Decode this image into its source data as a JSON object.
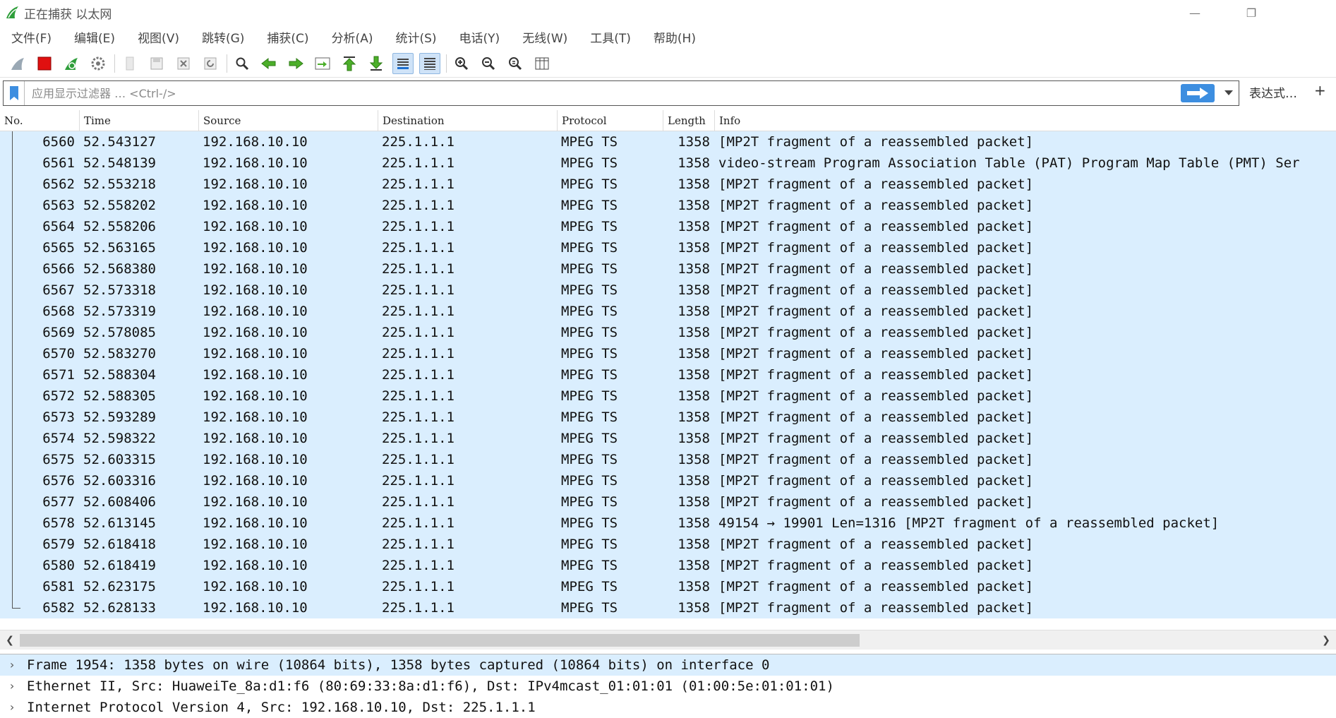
{
  "window": {
    "title": "正在捕获 以太网",
    "controls": {
      "minimize": "—",
      "restore": "❐",
      "close": ""
    }
  },
  "menu": [
    "文件(F)",
    "编辑(E)",
    "视图(V)",
    "跳转(G)",
    "捕获(C)",
    "分析(A)",
    "统计(S)",
    "电话(Y)",
    "无线(W)",
    "工具(T)",
    "帮助(H)"
  ],
  "toolbar": {
    "icons": [
      "shark-fin-icon",
      "stop-capture-icon",
      "restart-capture-icon",
      "capture-options-icon",
      "open-file-icon",
      "save-file-icon",
      "close-file-icon",
      "reload-file-icon",
      "find-packet-icon",
      "go-back-icon",
      "go-forward-icon",
      "go-to-packet-icon",
      "go-first-icon",
      "go-last-icon",
      "autoscroll-icon",
      "colorize-icon",
      "zoom-in-icon",
      "zoom-out-icon",
      "zoom-normal-icon",
      "resize-columns-icon"
    ]
  },
  "filter": {
    "placeholder": "应用显示过滤器 … <Ctrl-/>",
    "value": "",
    "expression_label": "表达式…",
    "right_label": "+"
  },
  "packet_list": {
    "columns": [
      "No.",
      "Time",
      "Source",
      "Destination",
      "Protocol",
      "Length",
      "Info"
    ],
    "rows": [
      {
        "no": "6560",
        "time": "52.543127",
        "src": "192.168.10.10",
        "dst": "225.1.1.1",
        "proto": "MPEG TS",
        "len": "1358",
        "info": "[MP2T fragment of a reassembled packet]"
      },
      {
        "no": "6561",
        "time": "52.548139",
        "src": "192.168.10.10",
        "dst": "225.1.1.1",
        "proto": "MPEG TS",
        "len": "1358",
        "info": "video-stream  Program Association Table (PAT) Program Map Table (PMT) Ser"
      },
      {
        "no": "6562",
        "time": "52.553218",
        "src": "192.168.10.10",
        "dst": "225.1.1.1",
        "proto": "MPEG TS",
        "len": "1358",
        "info": "[MP2T fragment of a reassembled packet]"
      },
      {
        "no": "6563",
        "time": "52.558202",
        "src": "192.168.10.10",
        "dst": "225.1.1.1",
        "proto": "MPEG TS",
        "len": "1358",
        "info": "[MP2T fragment of a reassembled packet]"
      },
      {
        "no": "6564",
        "time": "52.558206",
        "src": "192.168.10.10",
        "dst": "225.1.1.1",
        "proto": "MPEG TS",
        "len": "1358",
        "info": "[MP2T fragment of a reassembled packet]"
      },
      {
        "no": "6565",
        "time": "52.563165",
        "src": "192.168.10.10",
        "dst": "225.1.1.1",
        "proto": "MPEG TS",
        "len": "1358",
        "info": "[MP2T fragment of a reassembled packet]"
      },
      {
        "no": "6566",
        "time": "52.568380",
        "src": "192.168.10.10",
        "dst": "225.1.1.1",
        "proto": "MPEG TS",
        "len": "1358",
        "info": "[MP2T fragment of a reassembled packet]"
      },
      {
        "no": "6567",
        "time": "52.573318",
        "src": "192.168.10.10",
        "dst": "225.1.1.1",
        "proto": "MPEG TS",
        "len": "1358",
        "info": "[MP2T fragment of a reassembled packet]"
      },
      {
        "no": "6568",
        "time": "52.573319",
        "src": "192.168.10.10",
        "dst": "225.1.1.1",
        "proto": "MPEG TS",
        "len": "1358",
        "info": "[MP2T fragment of a reassembled packet]"
      },
      {
        "no": "6569",
        "time": "52.578085",
        "src": "192.168.10.10",
        "dst": "225.1.1.1",
        "proto": "MPEG TS",
        "len": "1358",
        "info": "[MP2T fragment of a reassembled packet]"
      },
      {
        "no": "6570",
        "time": "52.583270",
        "src": "192.168.10.10",
        "dst": "225.1.1.1",
        "proto": "MPEG TS",
        "len": "1358",
        "info": "[MP2T fragment of a reassembled packet]"
      },
      {
        "no": "6571",
        "time": "52.588304",
        "src": "192.168.10.10",
        "dst": "225.1.1.1",
        "proto": "MPEG TS",
        "len": "1358",
        "info": "[MP2T fragment of a reassembled packet]"
      },
      {
        "no": "6572",
        "time": "52.588305",
        "src": "192.168.10.10",
        "dst": "225.1.1.1",
        "proto": "MPEG TS",
        "len": "1358",
        "info": "[MP2T fragment of a reassembled packet]"
      },
      {
        "no": "6573",
        "time": "52.593289",
        "src": "192.168.10.10",
        "dst": "225.1.1.1",
        "proto": "MPEG TS",
        "len": "1358",
        "info": "[MP2T fragment of a reassembled packet]"
      },
      {
        "no": "6574",
        "time": "52.598322",
        "src": "192.168.10.10",
        "dst": "225.1.1.1",
        "proto": "MPEG TS",
        "len": "1358",
        "info": "[MP2T fragment of a reassembled packet]"
      },
      {
        "no": "6575",
        "time": "52.603315",
        "src": "192.168.10.10",
        "dst": "225.1.1.1",
        "proto": "MPEG TS",
        "len": "1358",
        "info": "[MP2T fragment of a reassembled packet]"
      },
      {
        "no": "6576",
        "time": "52.603316",
        "src": "192.168.10.10",
        "dst": "225.1.1.1",
        "proto": "MPEG TS",
        "len": "1358",
        "info": "[MP2T fragment of a reassembled packet]"
      },
      {
        "no": "6577",
        "time": "52.608406",
        "src": "192.168.10.10",
        "dst": "225.1.1.1",
        "proto": "MPEG TS",
        "len": "1358",
        "info": "[MP2T fragment of a reassembled packet]"
      },
      {
        "no": "6578",
        "time": "52.613145",
        "src": "192.168.10.10",
        "dst": "225.1.1.1",
        "proto": "MPEG TS",
        "len": "1358",
        "info": "49154 → 19901 Len=1316 [MP2T fragment of a reassembled packet]"
      },
      {
        "no": "6579",
        "time": "52.618418",
        "src": "192.168.10.10",
        "dst": "225.1.1.1",
        "proto": "MPEG TS",
        "len": "1358",
        "info": "[MP2T fragment of a reassembled packet]"
      },
      {
        "no": "6580",
        "time": "52.618419",
        "src": "192.168.10.10",
        "dst": "225.1.1.1",
        "proto": "MPEG TS",
        "len": "1358",
        "info": "[MP2T fragment of a reassembled packet]"
      },
      {
        "no": "6581",
        "time": "52.623175",
        "src": "192.168.10.10",
        "dst": "225.1.1.1",
        "proto": "MPEG TS",
        "len": "1358",
        "info": "[MP2T fragment of a reassembled packet]"
      },
      {
        "no": "6582",
        "time": "52.628133",
        "src": "192.168.10.10",
        "dst": "225.1.1.1",
        "proto": "MPEG TS",
        "len": "1358",
        "info": "[MP2T fragment of a reassembled packet]"
      }
    ]
  },
  "details": [
    {
      "text": "Frame 1954: 1358 bytes on wire (10864 bits), 1358 bytes captured (10864 bits) on interface 0",
      "selected": true
    },
    {
      "text": "Ethernet II, Src: HuaweiTe_8a:d1:f6 (80:69:33:8a:d1:f6), Dst: IPv4mcast_01:01:01 (01:00:5e:01:01:01)",
      "selected": false
    },
    {
      "text": "Internet Protocol Version 4, Src: 192.168.10.10, Dst: 225.1.1.1",
      "selected": false
    }
  ],
  "colors": {
    "row_bg": "#daeefe",
    "apply_button": "#3d8ee0",
    "stop_red": "#e01010",
    "shark_green": "#2e9e3a"
  }
}
